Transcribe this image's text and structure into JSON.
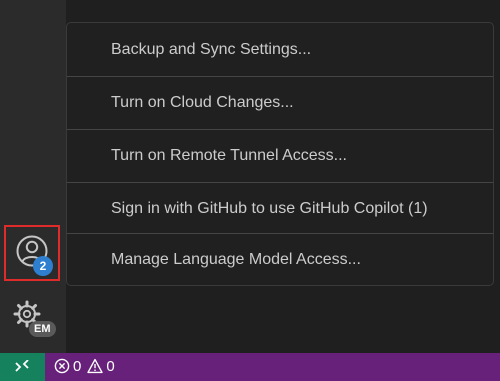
{
  "menu": {
    "items": [
      {
        "label": "Backup and Sync Settings..."
      },
      {
        "label": "Turn on Cloud Changes..."
      },
      {
        "label": "Turn on Remote Tunnel Access..."
      },
      {
        "label": "Sign in with GitHub to use GitHub Copilot (1)"
      },
      {
        "label": "Manage Language Model Access..."
      }
    ]
  },
  "activity_bar": {
    "accounts": {
      "icon": "account-icon",
      "badge": "2"
    },
    "manage": {
      "icon": "gear-icon",
      "badge": "EM"
    }
  },
  "status_bar": {
    "remote_icon": "remote-icon",
    "errors": {
      "icon": "error-icon",
      "count": "0"
    },
    "warnings": {
      "icon": "warning-icon",
      "count": "0"
    }
  },
  "colors": {
    "status_bar": "#68217a",
    "remote_button": "#16825d",
    "badge": "#2f7fd0",
    "highlight": "#e02b2b"
  }
}
